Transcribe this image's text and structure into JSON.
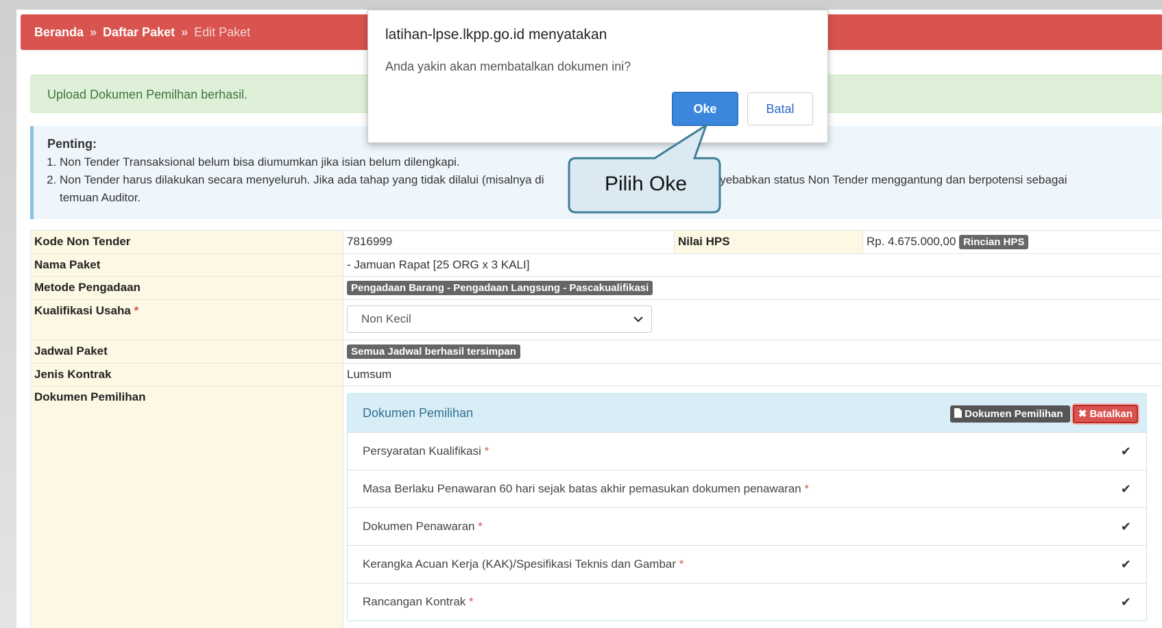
{
  "breadcrumb": {
    "home": "Beranda",
    "sep": "»",
    "list": "Daftar Paket",
    "current": "Edit Paket"
  },
  "alert": "Upload Dokumen Pemilhan berhasil.",
  "info": {
    "title": "Penting:",
    "line1": "Non Tender Transaksional belum bisa diumumkan jika isian belum dilengkapi.",
    "line2": "Non Tender harus dilakukan secara menyeluruh. Jika ada tahap yang tidak dilalui (misalnya di",
    "line2b": "an menyebabkan status Non Tender menggantung dan berpotensi sebagai",
    "line3": "temuan Auditor."
  },
  "table": {
    "kode_label": "Kode Non Tender",
    "kode_value": "7816999",
    "hps_label": "Nilai HPS",
    "hps_value": "Rp. 4.675.000,00",
    "hps_btn": "Rincian HPS",
    "nama_label": "Nama Paket",
    "nama_value": "- Jamuan Rapat [25 ORG x 3 KALI]",
    "metode_label": "Metode Pengadaan",
    "metode_value": "Pengadaan Barang - Pengadaan Langsung - Pascakualifikasi",
    "kual_label": "Kualifikasi Usaha",
    "required_mark": "*",
    "kual_value": "Non Kecil",
    "jadwal_label": "Jadwal Paket",
    "jadwal_value": "Semua Jadwal berhasil tersimpan",
    "jenis_label": "Jenis Kontrak",
    "jenis_value": "Lumsum",
    "dok_label": "Dokumen Pemilihan"
  },
  "panel": {
    "title": "Dokumen Pemilihan",
    "btn_doc": "Dokumen Pemilihan",
    "btn_cancel": "Batalkan",
    "items": [
      {
        "label": "Persyaratan Kualifikasi"
      },
      {
        "label": "Masa Berlaku Penawaran 60 hari sejak batas akhir pemasukan dokumen penawaran"
      },
      {
        "label": "Dokumen Penawaran"
      },
      {
        "label": "Kerangka Acuan Kerja (KAK)/Spesifikasi Teknis dan Gambar"
      },
      {
        "label": "Rancangan Kontrak"
      }
    ]
  },
  "dialog": {
    "title": "latihan-lpse.lkpp.go.id menyatakan",
    "message": "Anda yakin akan membatalkan dokumen ini?",
    "ok": "Oke",
    "cancel": "Batal"
  },
  "callout": "Pilih Oke",
  "colors": {
    "header": "#d9534f",
    "callout_fill": "#dbe9f3",
    "callout_border": "#3e7f96",
    "ok": "#3a87dd"
  }
}
